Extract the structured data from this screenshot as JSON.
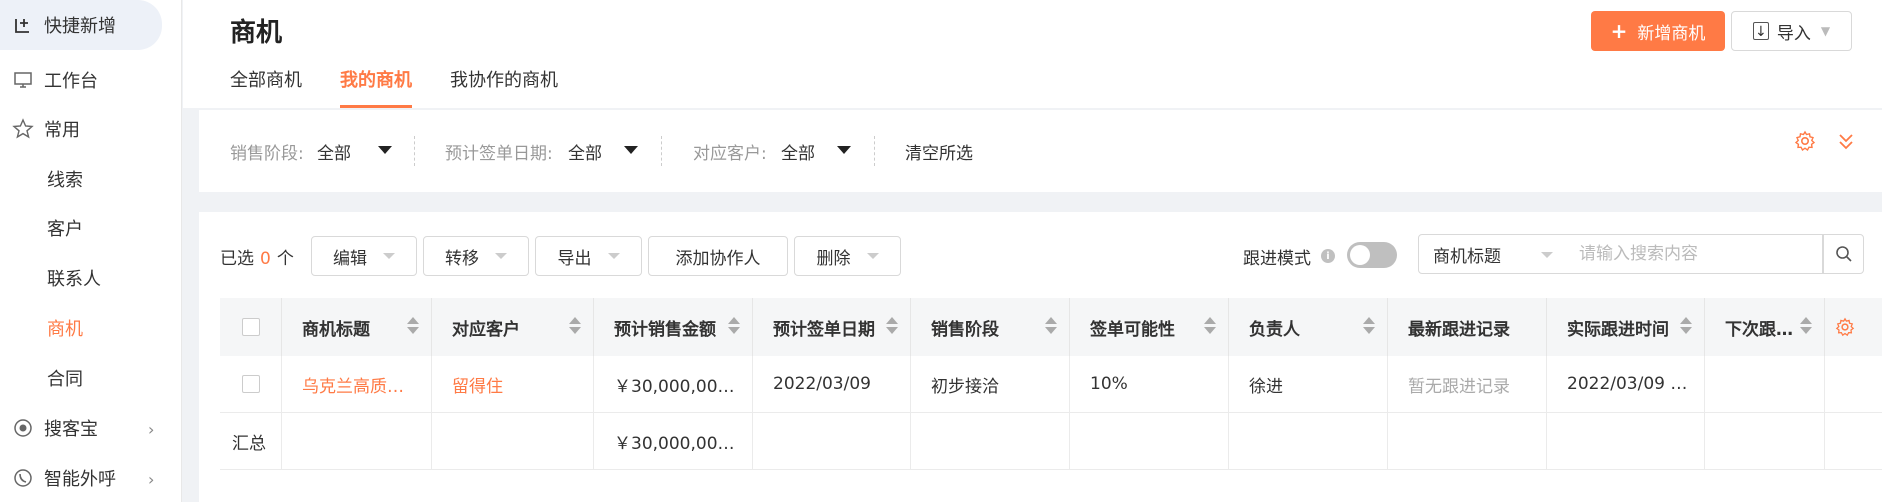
{
  "sidebar": {
    "items": [
      {
        "label": "快捷新增",
        "icon": "add-square-icon"
      },
      {
        "label": "工作台",
        "icon": "monitor-icon"
      },
      {
        "label": "常用",
        "icon": "star-icon"
      },
      {
        "label": "线索"
      },
      {
        "label": "客户"
      },
      {
        "label": "联系人"
      },
      {
        "label": "商机"
      },
      {
        "label": "合同"
      },
      {
        "label": "搜客宝",
        "icon": "search-treasure-icon"
      },
      {
        "label": "智能外呼",
        "icon": "phone-icon"
      }
    ],
    "active_color": "#ff7a45"
  },
  "header": {
    "title": "商机",
    "tabs": [
      {
        "label": "全部商机"
      },
      {
        "label": "我的商机"
      },
      {
        "label": "我协作的商机"
      }
    ],
    "new_button": "新增商机",
    "import_button": "导入"
  },
  "filter": {
    "stage_label": "销售阶段:",
    "stage_value": "全部",
    "date_label": "预计签单日期:",
    "date_value": "全部",
    "customer_label": "对应客户:",
    "customer_value": "全部",
    "clear_label": "清空所选"
  },
  "toolbar": {
    "selected_prefix": "已选",
    "selected_count": "0",
    "selected_suffix": "个",
    "edit": "编辑",
    "transfer": "转移",
    "export": "导出",
    "add_collaborator": "添加协作人",
    "delete": "删除",
    "follow_mode": "跟进模式",
    "search_field": "商机标题",
    "search_placeholder": "请输入搜索内容"
  },
  "table": {
    "columns": [
      "商机标题",
      "对应客户",
      "预计销售金额",
      "预计签单日期",
      "销售阶段",
      "签单可能性",
      "负责人",
      "最新跟进记录",
      "实际跟进时间",
      "下次跟…"
    ],
    "rows": [
      [
        "乌克兰高质…",
        "留得住",
        "￥30,000,00…",
        "2022/03/09",
        "初步接洽",
        "10%",
        "徐进",
        "暂无跟进记录",
        "2022/03/09 …",
        ""
      ]
    ],
    "summary": {
      "label": "汇总",
      "amount": "￥30,000,00…"
    }
  },
  "colors": {
    "accent": "#ff7a45"
  }
}
